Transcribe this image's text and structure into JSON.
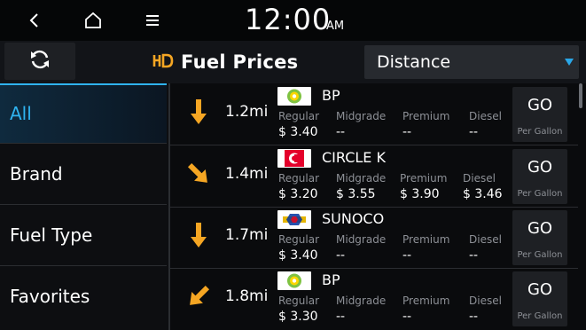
{
  "status": {
    "time": "12:00",
    "ampm": "AM"
  },
  "header": {
    "title": "Fuel Prices",
    "sort_value": "Distance"
  },
  "menu": [
    {
      "label": "All",
      "active": true
    },
    {
      "label": "Brand"
    },
    {
      "label": "Fuel Type"
    },
    {
      "label": "Favorites"
    }
  ],
  "labels": {
    "regular": "Regular",
    "midgrade": "Midgrade",
    "premium": "Premium",
    "diesel": "Diesel",
    "go": "GO",
    "per_gallon": "Per Gallon"
  },
  "stations": [
    {
      "distance": "1.2mi",
      "name": "BP",
      "logo": "bp-logo",
      "arrow": "down-arrow-icon",
      "regular": "$ 3.40",
      "midgrade": "--",
      "premium": "--",
      "diesel": "--"
    },
    {
      "distance": "1.4mi",
      "name": "CIRCLE K",
      "logo": "circle-k-logo",
      "arrow": "down-right-arrow-icon",
      "regular": "$ 3.20",
      "midgrade": "$ 3.55",
      "premium": "$ 3.90",
      "diesel": "$ 3.46"
    },
    {
      "distance": "1.7mi",
      "name": "SUNOCO",
      "logo": "sunoco-logo",
      "arrow": "down-arrow-icon",
      "regular": "$ 3.40",
      "midgrade": "--",
      "premium": "--",
      "diesel": "--"
    },
    {
      "distance": "1.8mi",
      "name": "BP",
      "logo": "bp-logo",
      "arrow": "down-left-arrow-icon",
      "regular": "$ 3.30",
      "midgrade": "--",
      "premium": "--",
      "diesel": "--"
    }
  ],
  "colors": {
    "accent": "#2fb3f0",
    "arrow": "#f5a623",
    "background": "#0a0b0d"
  }
}
